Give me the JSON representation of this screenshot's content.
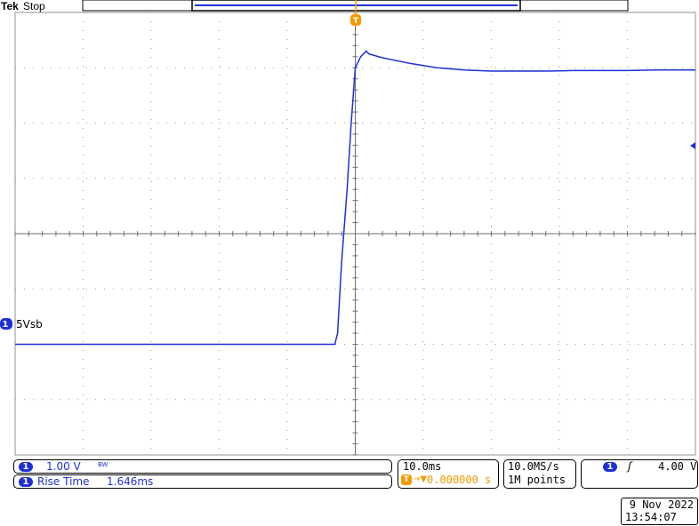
{
  "header": {
    "brand": "Tek",
    "run_state": "Stop"
  },
  "chart_data": {
    "type": "line",
    "title": "",
    "xlabel": "",
    "ylabel": "",
    "x_divisions": 10,
    "y_divisions": 8,
    "xlim_ms": [
      -50,
      50
    ],
    "ylim_div": [
      -4,
      4
    ],
    "series": [
      {
        "name": "5Vsb",
        "color": "#1f2fd6",
        "x_ms": [
          -50,
          -3.0,
          -2.6,
          -2.0,
          -1.2,
          -0.6,
          0.0,
          0.8,
          1.6,
          2.0,
          4,
          8,
          12,
          16,
          20,
          24,
          28,
          32,
          36,
          40,
          44,
          50
        ],
        "y_div": [
          -2.0,
          -2.0,
          -1.8,
          -0.5,
          0.8,
          2.0,
          3.0,
          3.2,
          3.3,
          3.25,
          3.18,
          3.08,
          3.0,
          2.96,
          2.94,
          2.94,
          2.94,
          2.95,
          2.95,
          2.95,
          2.96,
          2.96
        ]
      }
    ],
    "channel_label": "5Vsb",
    "trigger_marker": "T",
    "grid": "dotted"
  },
  "readouts": {
    "ch1_scale": "1.00 V",
    "bandwidth_tag": "BW",
    "measurement_label": "Rise Time",
    "measurement_value": "1.646ms",
    "timebase": "10.0ms",
    "trigger_position": "0.000000 s",
    "sample_rate": "10.0MS/s",
    "record_length": "1M points",
    "trigger_level": "4.00 V",
    "date": "9 Nov 2022",
    "time": "13:54:07",
    "channel_number": "1"
  }
}
